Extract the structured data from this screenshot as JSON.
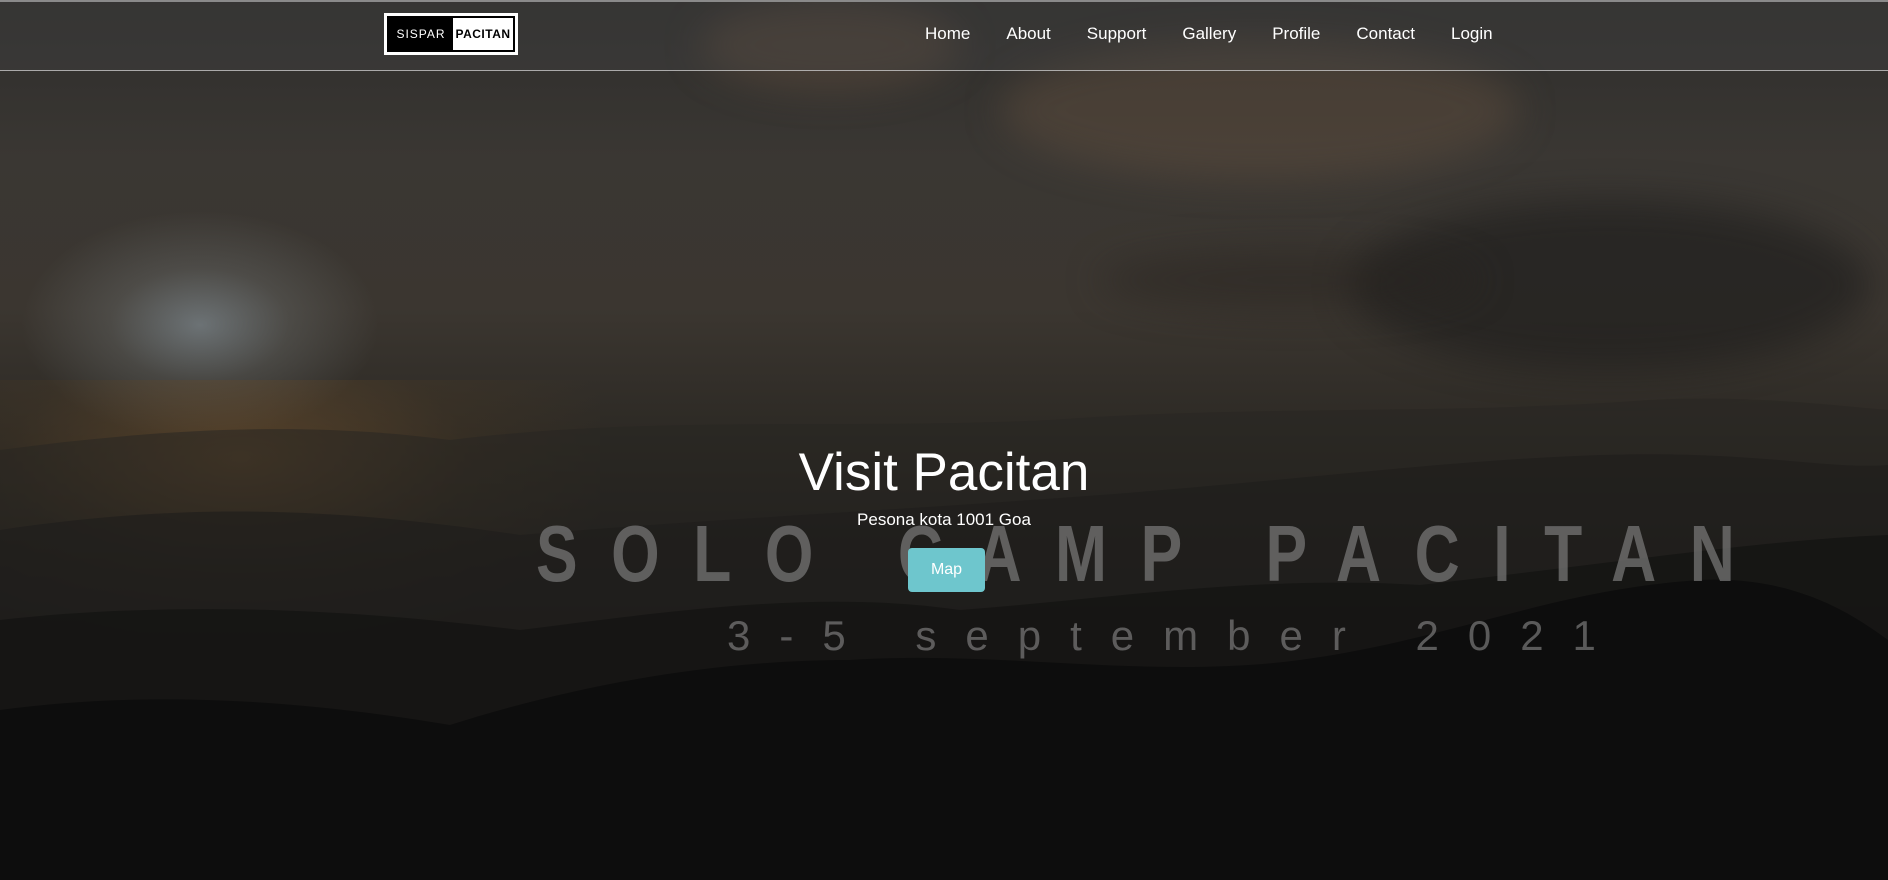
{
  "header": {
    "logo": {
      "left_text": "SISPAR",
      "right_text": "PACITAN"
    },
    "nav": [
      {
        "label": "Home"
      },
      {
        "label": "About"
      },
      {
        "label": "Support"
      },
      {
        "label": "Gallery"
      },
      {
        "label": "Profile"
      },
      {
        "label": "Contact"
      },
      {
        "label": "Login"
      }
    ]
  },
  "hero": {
    "title": "Visit Pacitan",
    "subtitle": "Pesona kota 1001 Goa",
    "button_label": "Map",
    "background": {
      "watermark_title": "SOLO CAMP PACITAN",
      "watermark_date": "3-5 september 2021"
    }
  },
  "colors": {
    "button_bg": "#6ec6cd",
    "text": "#ffffff",
    "nav_border": "#d2d2d2"
  }
}
